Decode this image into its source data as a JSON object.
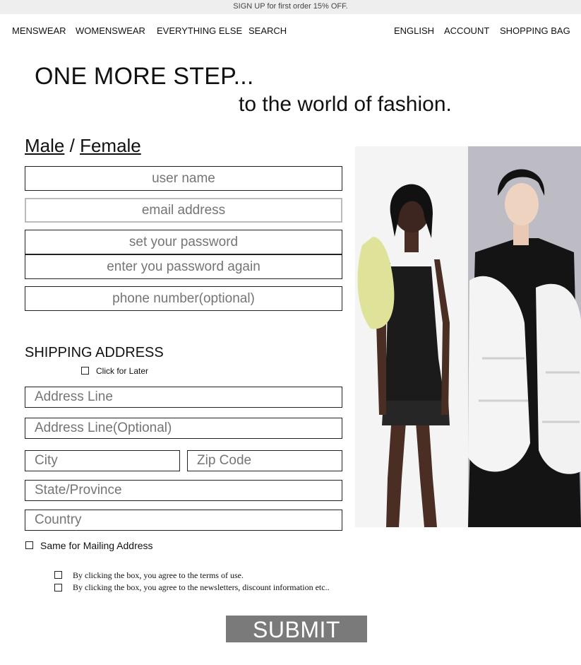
{
  "banner": {
    "text": "SIGN UP for first order 15% OFF."
  },
  "nav": {
    "menswear": "MENSWEAR",
    "womenswear": "WOMENSWEAR",
    "everything_else": "EVERYTHING ELSE",
    "search": "SEARCH",
    "language": "ENGLISH",
    "account": "ACCOUNT",
    "shopping_bag": "SHOPPING BAG"
  },
  "hero": {
    "title": "ONE MORE STEP...",
    "subtitle": "to the world of fashion."
  },
  "gender": {
    "male": "Male",
    "separator": "/",
    "female": "Female"
  },
  "account_fields": {
    "username": "user name",
    "email": "email address",
    "password": "set your password",
    "password_again": "enter you password again",
    "phone": "phone number(optional)"
  },
  "shipping": {
    "title": "SHIPPING ADDRESS",
    "later_label": "Click for Later",
    "address_line": "Address Line",
    "address_line_optional": "Address Line(Optional)",
    "city": "City",
    "zip": "Zip Code",
    "state": "State/Province",
    "country": "Country",
    "same_mailing_label": "Same for Mailing Address"
  },
  "agreements": {
    "terms": "By clicking the box, you agree to the terms of use.",
    "newsletter": "By clicking the box, you agree to the newsletters, discount information etc.."
  },
  "submit": {
    "label": "SUBMIT"
  },
  "colors": {
    "submit_bg": "#7a7a7a",
    "banner_bg": "#eeeeee",
    "placeholder": "#999999"
  }
}
